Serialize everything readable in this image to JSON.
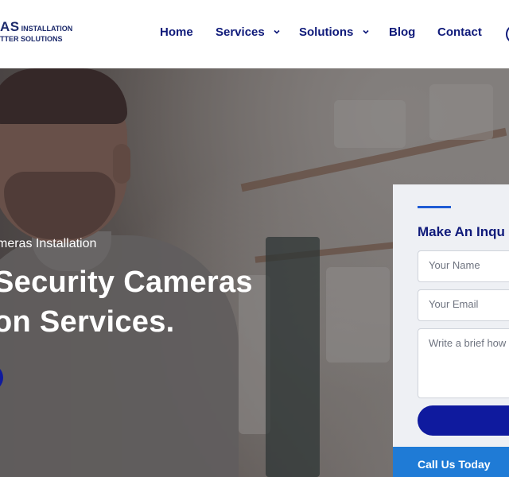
{
  "header": {
    "logo_line1_big": "AS",
    "logo_line1_small": "INSTALLATION",
    "logo_line2": "TTER SOLUTIONS"
  },
  "nav": {
    "items": [
      {
        "label": "Home",
        "has_dropdown": false
      },
      {
        "label": "Services",
        "has_dropdown": true
      },
      {
        "label": "Solutions",
        "has_dropdown": true
      },
      {
        "label": "Blog",
        "has_dropdown": false
      },
      {
        "label": "Contact",
        "has_dropdown": false
      }
    ]
  },
  "hero": {
    "subtitle": "meras Installation",
    "title_line1": "Security Cameras",
    "title_line2": "on Services."
  },
  "inquiry": {
    "title": "Make An Inqu",
    "name_placeholder": "Your Name",
    "email_placeholder": "Your Email",
    "message_placeholder": "Write a brief how",
    "call_text": "Call Us Today"
  },
  "colors": {
    "brand_navy": "#0f1a7a",
    "button_blue": "#0f1a9e",
    "accent_blue": "#1f5bd4",
    "call_bar": "#1f7bd6"
  },
  "icons": {
    "dropdown": "chevron-down-icon",
    "header_action": "circle-icon"
  }
}
